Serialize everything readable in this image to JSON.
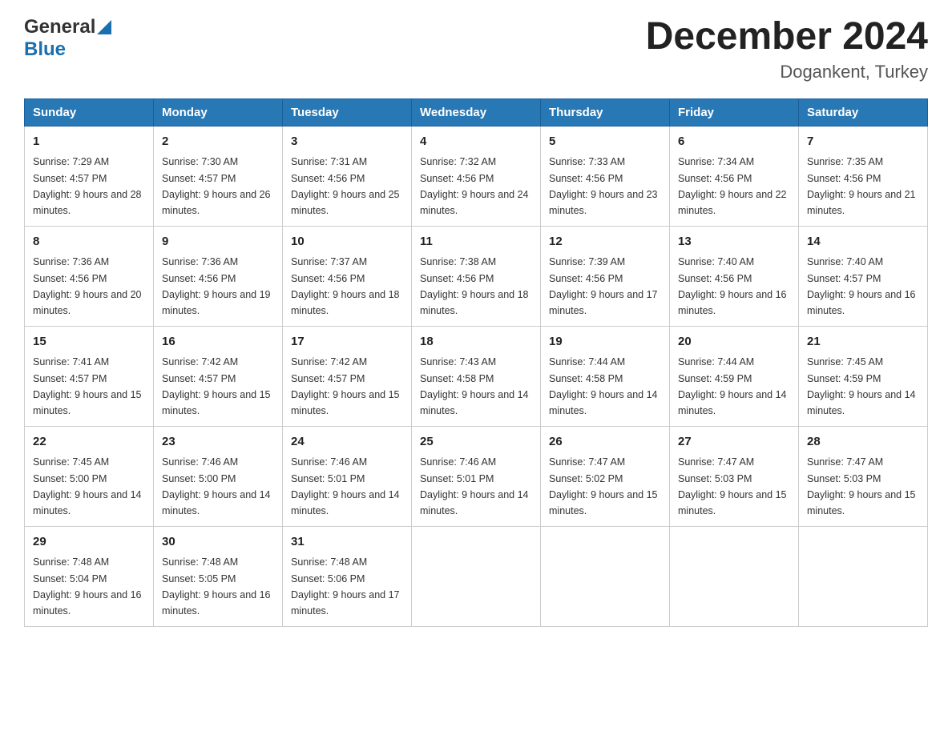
{
  "logo": {
    "general": "General",
    "blue": "Blue"
  },
  "title": {
    "month_year": "December 2024",
    "location": "Dogankent, Turkey"
  },
  "weekdays": [
    "Sunday",
    "Monday",
    "Tuesday",
    "Wednesday",
    "Thursday",
    "Friday",
    "Saturday"
  ],
  "weeks": [
    [
      {
        "day": "1",
        "sunrise": "7:29 AM",
        "sunset": "4:57 PM",
        "daylight": "9 hours and 28 minutes."
      },
      {
        "day": "2",
        "sunrise": "7:30 AM",
        "sunset": "4:57 PM",
        "daylight": "9 hours and 26 minutes."
      },
      {
        "day": "3",
        "sunrise": "7:31 AM",
        "sunset": "4:56 PM",
        "daylight": "9 hours and 25 minutes."
      },
      {
        "day": "4",
        "sunrise": "7:32 AM",
        "sunset": "4:56 PM",
        "daylight": "9 hours and 24 minutes."
      },
      {
        "day": "5",
        "sunrise": "7:33 AM",
        "sunset": "4:56 PM",
        "daylight": "9 hours and 23 minutes."
      },
      {
        "day": "6",
        "sunrise": "7:34 AM",
        "sunset": "4:56 PM",
        "daylight": "9 hours and 22 minutes."
      },
      {
        "day": "7",
        "sunrise": "7:35 AM",
        "sunset": "4:56 PM",
        "daylight": "9 hours and 21 minutes."
      }
    ],
    [
      {
        "day": "8",
        "sunrise": "7:36 AM",
        "sunset": "4:56 PM",
        "daylight": "9 hours and 20 minutes."
      },
      {
        "day": "9",
        "sunrise": "7:36 AM",
        "sunset": "4:56 PM",
        "daylight": "9 hours and 19 minutes."
      },
      {
        "day": "10",
        "sunrise": "7:37 AM",
        "sunset": "4:56 PM",
        "daylight": "9 hours and 18 minutes."
      },
      {
        "day": "11",
        "sunrise": "7:38 AM",
        "sunset": "4:56 PM",
        "daylight": "9 hours and 18 minutes."
      },
      {
        "day": "12",
        "sunrise": "7:39 AM",
        "sunset": "4:56 PM",
        "daylight": "9 hours and 17 minutes."
      },
      {
        "day": "13",
        "sunrise": "7:40 AM",
        "sunset": "4:56 PM",
        "daylight": "9 hours and 16 minutes."
      },
      {
        "day": "14",
        "sunrise": "7:40 AM",
        "sunset": "4:57 PM",
        "daylight": "9 hours and 16 minutes."
      }
    ],
    [
      {
        "day": "15",
        "sunrise": "7:41 AM",
        "sunset": "4:57 PM",
        "daylight": "9 hours and 15 minutes."
      },
      {
        "day": "16",
        "sunrise": "7:42 AM",
        "sunset": "4:57 PM",
        "daylight": "9 hours and 15 minutes."
      },
      {
        "day": "17",
        "sunrise": "7:42 AM",
        "sunset": "4:57 PM",
        "daylight": "9 hours and 15 minutes."
      },
      {
        "day": "18",
        "sunrise": "7:43 AM",
        "sunset": "4:58 PM",
        "daylight": "9 hours and 14 minutes."
      },
      {
        "day": "19",
        "sunrise": "7:44 AM",
        "sunset": "4:58 PM",
        "daylight": "9 hours and 14 minutes."
      },
      {
        "day": "20",
        "sunrise": "7:44 AM",
        "sunset": "4:59 PM",
        "daylight": "9 hours and 14 minutes."
      },
      {
        "day": "21",
        "sunrise": "7:45 AM",
        "sunset": "4:59 PM",
        "daylight": "9 hours and 14 minutes."
      }
    ],
    [
      {
        "day": "22",
        "sunrise": "7:45 AM",
        "sunset": "5:00 PM",
        "daylight": "9 hours and 14 minutes."
      },
      {
        "day": "23",
        "sunrise": "7:46 AM",
        "sunset": "5:00 PM",
        "daylight": "9 hours and 14 minutes."
      },
      {
        "day": "24",
        "sunrise": "7:46 AM",
        "sunset": "5:01 PM",
        "daylight": "9 hours and 14 minutes."
      },
      {
        "day": "25",
        "sunrise": "7:46 AM",
        "sunset": "5:01 PM",
        "daylight": "9 hours and 14 minutes."
      },
      {
        "day": "26",
        "sunrise": "7:47 AM",
        "sunset": "5:02 PM",
        "daylight": "9 hours and 15 minutes."
      },
      {
        "day": "27",
        "sunrise": "7:47 AM",
        "sunset": "5:03 PM",
        "daylight": "9 hours and 15 minutes."
      },
      {
        "day": "28",
        "sunrise": "7:47 AM",
        "sunset": "5:03 PM",
        "daylight": "9 hours and 15 minutes."
      }
    ],
    [
      {
        "day": "29",
        "sunrise": "7:48 AM",
        "sunset": "5:04 PM",
        "daylight": "9 hours and 16 minutes."
      },
      {
        "day": "30",
        "sunrise": "7:48 AM",
        "sunset": "5:05 PM",
        "daylight": "9 hours and 16 minutes."
      },
      {
        "day": "31",
        "sunrise": "7:48 AM",
        "sunset": "5:06 PM",
        "daylight": "9 hours and 17 minutes."
      },
      null,
      null,
      null,
      null
    ]
  ],
  "labels": {
    "sunrise": "Sunrise:",
    "sunset": "Sunset:",
    "daylight": "Daylight:"
  }
}
